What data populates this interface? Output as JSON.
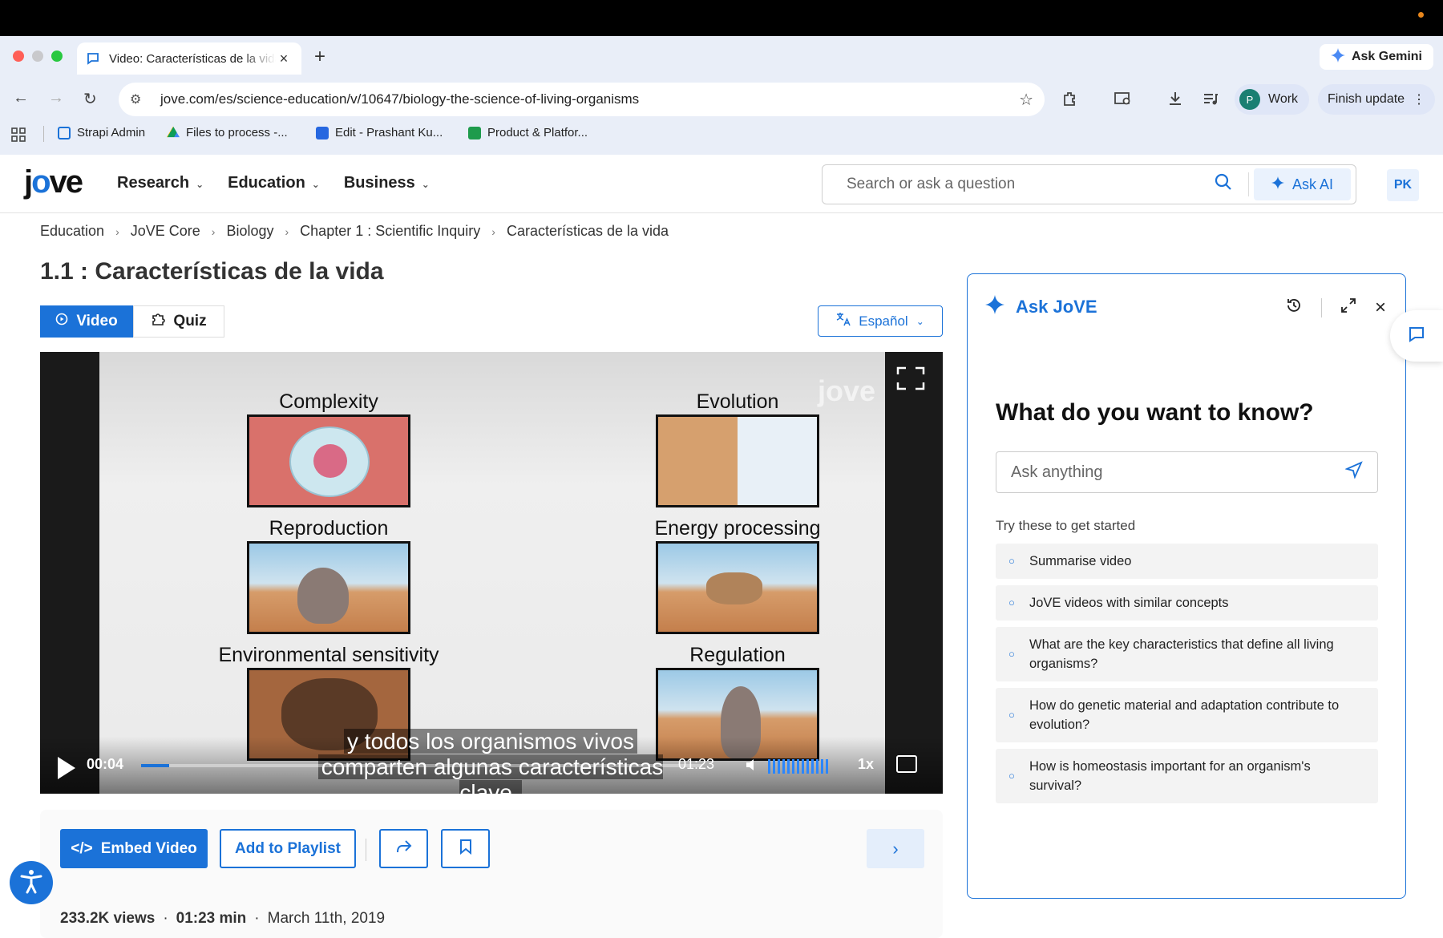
{
  "browser": {
    "tab_title": "Video: Características de la vida",
    "url": "jove.com/es/science-education/v/10647/biology-the-science-of-living-organisms",
    "ask_gemini": "Ask Gemini",
    "profile_initial": "P",
    "profile_name": "Work",
    "finish_update": "Finish update",
    "bookmarks": [
      {
        "label": "Strapi Admin"
      },
      {
        "label": "Files to process -..."
      },
      {
        "label": "Edit - Prashant Ku..."
      },
      {
        "label": "Product & Platfor..."
      }
    ]
  },
  "header": {
    "nav": [
      "Research",
      "Education",
      "Business"
    ],
    "search_placeholder": "Search or ask a question",
    "ask_ai": "Ask AI",
    "user_initials": "PK"
  },
  "breadcrumb": [
    "Education",
    "JoVE Core",
    "Biology",
    "Chapter 1 : Scientific Inquiry",
    "Características de la vida"
  ],
  "page_title": "1.1 : Características de la vida",
  "tabs": {
    "video": "Video",
    "quiz": "Quiz"
  },
  "language": "Español",
  "video": {
    "labels": [
      "Complexity",
      "Evolution",
      "Reproduction",
      "Energy processing",
      "Environmental sensitivity",
      "Regulation"
    ],
    "subtitle_line1": "y todos los organismos vivos",
    "subtitle_line2": "comparten algunas características clave.",
    "current_time": "00:04",
    "total_time": "01:23",
    "progress": 0.05,
    "speed": "1x",
    "watermark": "jove"
  },
  "actions": {
    "embed": "Embed Video",
    "playlist": "Add to Playlist"
  },
  "meta": {
    "views": "233.2K views",
    "duration": "01:23 min",
    "date": "March 11th, 2019",
    "dot": "·"
  },
  "ask_panel": {
    "title": "Ask JoVE",
    "question": "What do you want to know?",
    "input_placeholder": "Ask anything",
    "try_label": "Try these to get started",
    "suggestions": [
      "Summarise video",
      "JoVE videos with similar concepts",
      "What are the key characteristics that define all living organisms?",
      "How do genetic material and adaptation contribute to evolution?",
      "How is homeostasis important for an organism's survival?"
    ]
  },
  "colors": {
    "brand": "#1b72d8"
  }
}
